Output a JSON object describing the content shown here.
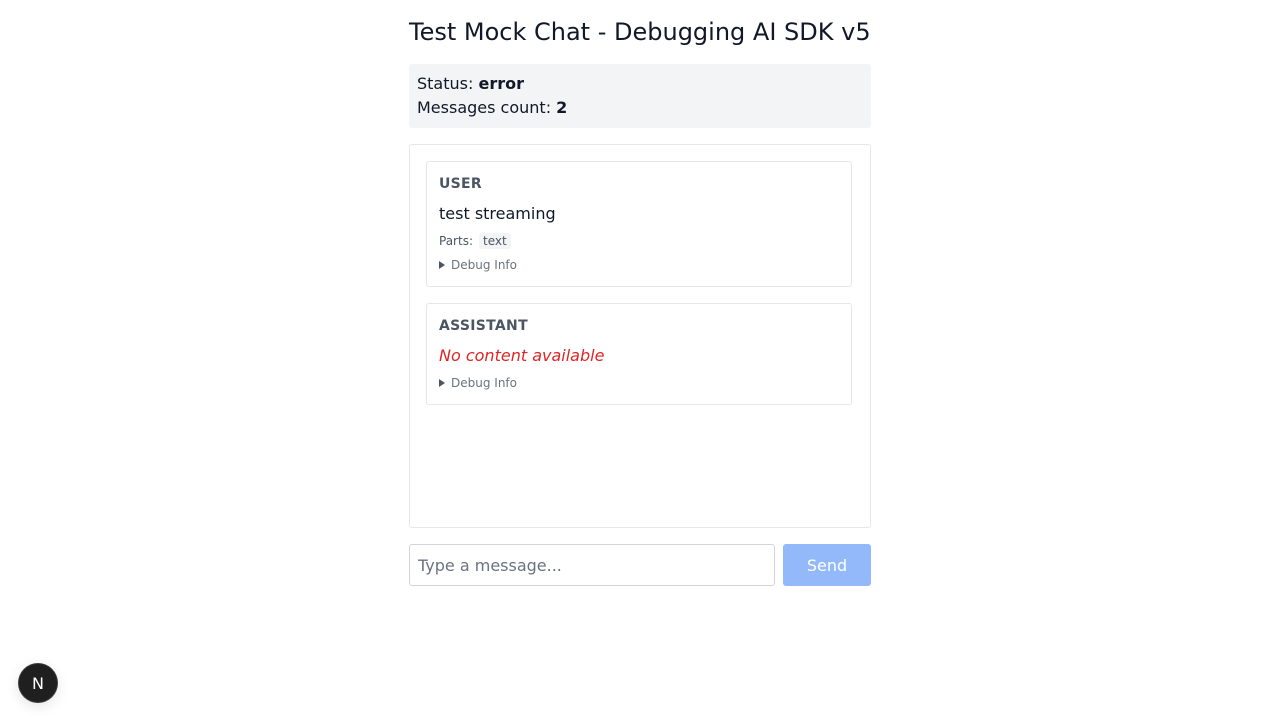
{
  "page": {
    "title": "Test Mock Chat - Debugging AI SDK v5"
  },
  "status": {
    "status_label": "Status:",
    "status_value": "error",
    "count_label": "Messages count:",
    "count_value": "2"
  },
  "messages": [
    {
      "role": "USER",
      "content": "test streaming",
      "parts_label": "Parts:",
      "parts": [
        "text"
      ],
      "debug_label": "Debug Info"
    },
    {
      "role": "ASSISTANT",
      "content": "No content available",
      "debug_label": "Debug Info"
    }
  ],
  "composer": {
    "placeholder": "Type a message...",
    "value": "",
    "send_label": "Send"
  },
  "dev_badge": {
    "letter": "N"
  },
  "colors": {
    "error_text": "#dc2626",
    "send_button_disabled": "#93b9fb",
    "status_background": "#f3f4f6"
  }
}
